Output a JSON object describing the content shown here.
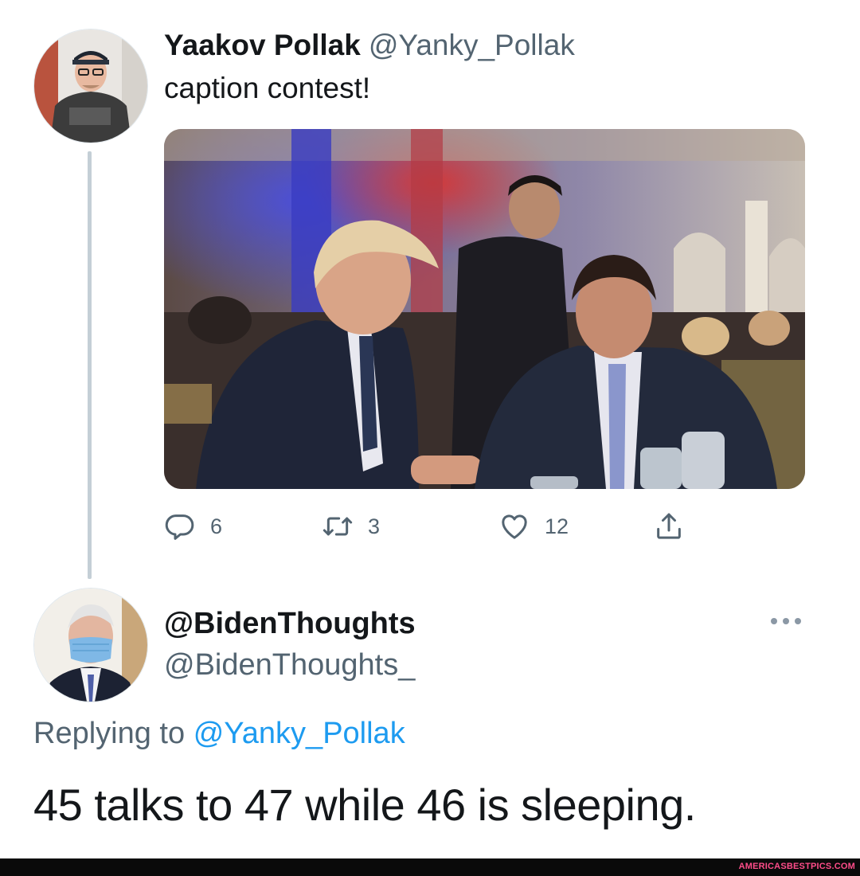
{
  "tweet": {
    "author_name": "Yaakov Pollak",
    "author_handle": "@Yanky_Pollak",
    "text": "caption contest!",
    "stats": {
      "replies": "6",
      "retweets": "3",
      "likes": "12"
    },
    "icons": {
      "reply": "reply-icon",
      "retweet": "retweet-icon",
      "like": "heart-icon",
      "share": "share-icon"
    }
  },
  "reply": {
    "author_name": "@BidenThoughts",
    "author_handle": "@BidenThoughts_",
    "replying_prefix": "Replying to",
    "replying_to": "@Yanky_Pollak",
    "text": "45 talks to 47 while 46 is sleeping.",
    "more_icon": "more-icon"
  },
  "watermark": "AMERICASBESTPICS.COM",
  "colors": {
    "text": "#14171a",
    "secondary": "#536471",
    "link": "#1d9bf0",
    "thread_line": "#c4cfd6",
    "watermark": "#ff4d8a"
  }
}
